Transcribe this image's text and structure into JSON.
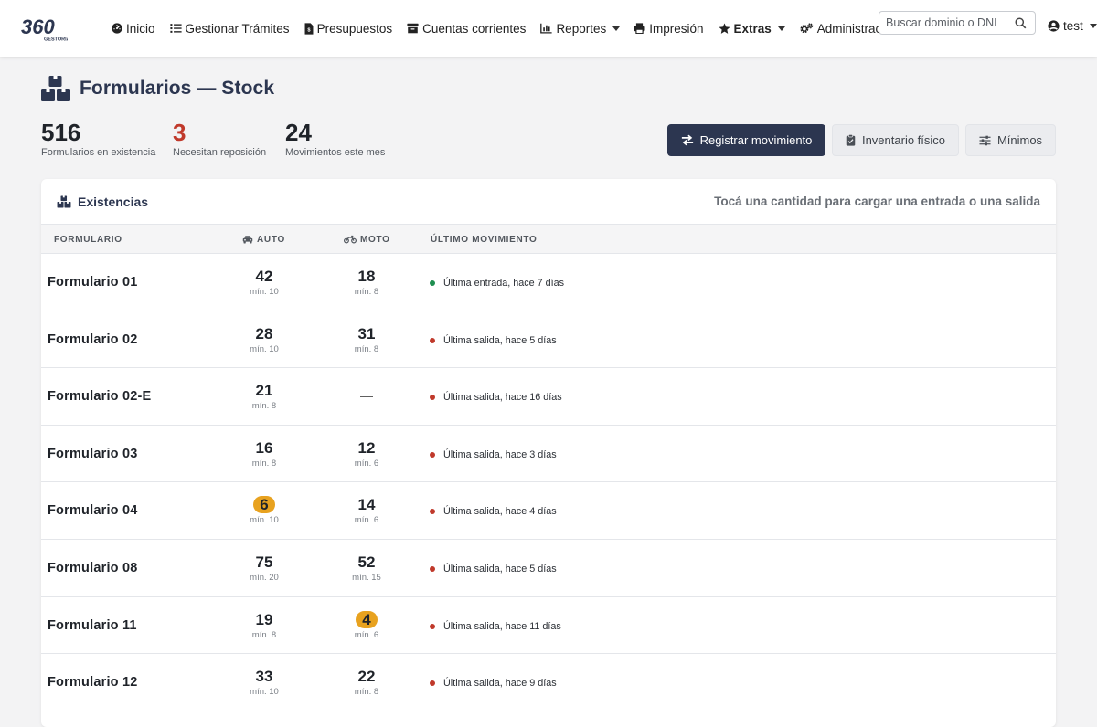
{
  "nav": {
    "brand": "360 GESTORIA",
    "items": [
      {
        "label": "Inicio",
        "icon": "dashboard-icon",
        "dropdown": false,
        "bold": false
      },
      {
        "label": "Gestionar Trámites",
        "icon": "list-icon",
        "dropdown": false,
        "bold": false
      },
      {
        "label": "Presupuestos",
        "icon": "file-invoice-icon",
        "dropdown": false,
        "bold": false
      },
      {
        "label": "Cuentas corrientes",
        "icon": "archive-icon",
        "dropdown": false,
        "bold": false
      },
      {
        "label": "Reportes",
        "icon": "chart-icon",
        "dropdown": true,
        "bold": false
      },
      {
        "label": "Impresión",
        "icon": "printer-icon",
        "dropdown": false,
        "bold": false
      },
      {
        "label": "Extras",
        "icon": "star-icon",
        "dropdown": true,
        "bold": true
      },
      {
        "label": "Administración",
        "icon": "gears-icon",
        "dropdown": true,
        "bold": false
      }
    ],
    "search_placeholder": "Buscar dominio o DNI",
    "user": "test"
  },
  "page": {
    "title": "Formularios — Stock"
  },
  "stats": [
    {
      "value": "516",
      "label": "Formularios en existencia",
      "alert": false
    },
    {
      "value": "3",
      "label": "Necesitan reposición",
      "alert": true
    },
    {
      "value": "24",
      "label": "Movimientos este mes",
      "alert": false
    }
  ],
  "actions": {
    "register": "Registrar movimiento",
    "inventory": "Inventario físico",
    "minimums": "Mínimos"
  },
  "card": {
    "title": "Existencias",
    "hint": "Tocá una cantidad para cargar una entrada o una salida"
  },
  "table": {
    "headers": {
      "form": "FORMULARIO",
      "auto": "AUTO",
      "moto": "MOTO",
      "last": "ÚLTIMO MOVIMIENTO"
    },
    "rows": [
      {
        "name": "Formulario 01",
        "auto": {
          "value": "42",
          "min": "mín. 10",
          "low": false
        },
        "moto": {
          "value": "18",
          "min": "mín. 8",
          "low": false
        },
        "last": "Última entrada, hace 7 días",
        "type": "in"
      },
      {
        "name": "Formulario 02",
        "auto": {
          "value": "28",
          "min": "mín. 10",
          "low": false
        },
        "moto": {
          "value": "31",
          "min": "mín. 8",
          "low": false
        },
        "last": "Última salida, hace 5 días",
        "type": "out"
      },
      {
        "name": "Formulario 02-E",
        "auto": {
          "value": "21",
          "min": "mín. 8",
          "low": false
        },
        "moto": null,
        "last": "Última salida, hace 16 días",
        "type": "out"
      },
      {
        "name": "Formulario 03",
        "auto": {
          "value": "16",
          "min": "mín. 8",
          "low": false
        },
        "moto": {
          "value": "12",
          "min": "mín. 6",
          "low": false
        },
        "last": "Última salida, hace 3 días",
        "type": "out"
      },
      {
        "name": "Formulario 04",
        "auto": {
          "value": "6",
          "min": "mín. 10",
          "low": true
        },
        "moto": {
          "value": "14",
          "min": "mín. 6",
          "low": false
        },
        "last": "Última salida, hace 4 días",
        "type": "out"
      },
      {
        "name": "Formulario 08",
        "auto": {
          "value": "75",
          "min": "mín. 20",
          "low": false
        },
        "moto": {
          "value": "52",
          "min": "mín. 15",
          "low": false
        },
        "last": "Última salida, hace 5 días",
        "type": "out"
      },
      {
        "name": "Formulario 11",
        "auto": {
          "value": "19",
          "min": "mín. 8",
          "low": false
        },
        "moto": {
          "value": "4",
          "min": "mín. 6",
          "low": true
        },
        "last": "Última salida, hace 11 días",
        "type": "out"
      },
      {
        "name": "Formulario 12",
        "auto": {
          "value": "33",
          "min": "mín. 10",
          "low": false
        },
        "moto": {
          "value": "22",
          "min": "mín. 8",
          "low": false
        },
        "last": "Última salida, hace 9 días",
        "type": "out"
      }
    ],
    "empty_mark": "—"
  },
  "colors": {
    "primary": "#2c3650",
    "alert": "#c0392b",
    "low_badge": "#e8a21f",
    "entry_dot": "#1e8e50"
  }
}
